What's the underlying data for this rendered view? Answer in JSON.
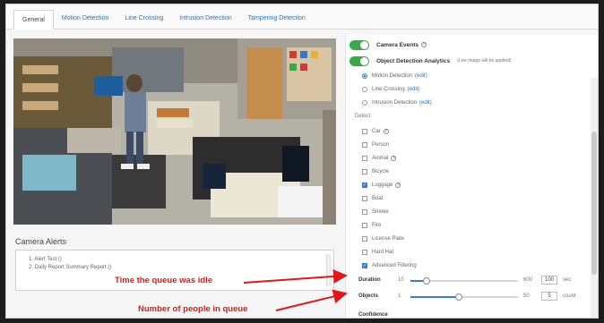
{
  "tabs": [
    {
      "label": "General"
    },
    {
      "label": "Motion Detection"
    },
    {
      "label": "Line Crossing"
    },
    {
      "label": "Intrusion Detection"
    },
    {
      "label": "Tampering Detection"
    }
  ],
  "alerts": {
    "title": "Camera Alerts",
    "items": [
      "1. Alert Test ()",
      "2. Daily Report Summary Report ()"
    ]
  },
  "panel": {
    "camera_events": "Camera Events",
    "object_detection": "Object Detection Analytics",
    "object_note": "(Live image will be applied)",
    "analytics": [
      {
        "label": "Motion Detection",
        "edit": "(edit)",
        "on": true
      },
      {
        "label": "Line Crossing",
        "edit": "(edit)",
        "on": false
      },
      {
        "label": "Intrusion Detection",
        "edit": "(edit)",
        "on": false
      }
    ],
    "detect_label": "Detect",
    "detect": [
      {
        "label": "Car",
        "on": false
      },
      {
        "label": "Person",
        "on": false
      },
      {
        "label": "Animal",
        "on": false
      },
      {
        "label": "Bicycle",
        "on": false
      },
      {
        "label": "Luggage",
        "on": true
      },
      {
        "label": "Boat",
        "on": false
      },
      {
        "label": "Smoke",
        "on": false
      },
      {
        "label": "Fire",
        "on": false
      },
      {
        "label": "License Plate",
        "on": false
      },
      {
        "label": "Hard Hat",
        "on": false
      },
      {
        "label": "Advanced Filtering",
        "on": true
      }
    ],
    "duration": {
      "label": "Duration",
      "min": "10",
      "max": "600",
      "value": "100",
      "unit": "sec",
      "level": 0.15
    },
    "objects": {
      "label": "Objects",
      "min": "1",
      "max": "50",
      "value": "5",
      "unit": "count",
      "level": 0.45
    },
    "confidence": "Confidence"
  },
  "annotations": {
    "duration_note": "Time the queue was idle",
    "objects_note": "Number of people in queue"
  },
  "colors": {
    "toggle": "#3aa94a",
    "accent": "#3a7bd5",
    "annotation": "#e01818"
  }
}
